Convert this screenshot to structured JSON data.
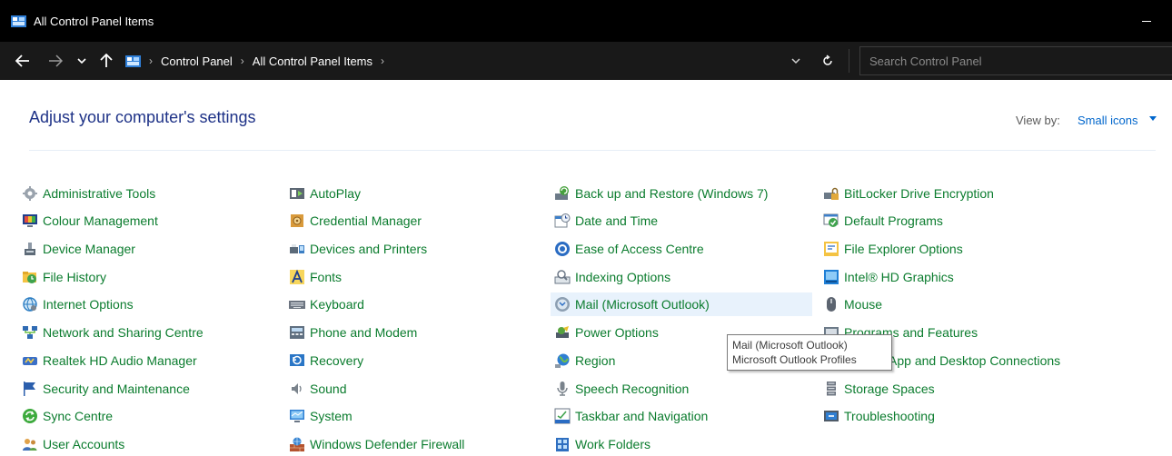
{
  "window": {
    "title": "All Control Panel Items"
  },
  "address": {
    "crumbs": [
      "Control Panel",
      "All Control Panel Items"
    ],
    "search_placeholder": "Search Control Panel"
  },
  "header": {
    "title": "Adjust your computer's settings",
    "view_by_label": "View by:",
    "view_by_value": "Small icons"
  },
  "columns": [
    [
      "Administrative Tools",
      "Colour Management",
      "Device Manager",
      "File History",
      "Internet Options",
      "Network and Sharing Centre",
      "Realtek HD Audio Manager",
      "Security and Maintenance",
      "Sync Centre",
      "User Accounts"
    ],
    [
      "AutoPlay",
      "Credential Manager",
      "Devices and Printers",
      "Fonts",
      "Keyboard",
      "Phone and Modem",
      "Recovery",
      "Sound",
      "System",
      "Windows Defender Firewall"
    ],
    [
      "Back up and Restore (Windows 7)",
      "Date and Time",
      "Ease of Access Centre",
      "Indexing Options",
      "Mail (Microsoft Outlook)",
      "Power Options",
      "Region",
      "Speech Recognition",
      "Taskbar and Navigation",
      "Work Folders"
    ],
    [
      "BitLocker Drive Encryption",
      "Default Programs",
      "File Explorer Options",
      "Intel® HD Graphics",
      "Mouse",
      "Programs and Features",
      "RemoteApp and Desktop Connections",
      "Storage Spaces",
      "Troubleshooting"
    ]
  ],
  "tooltip": {
    "line1": "Mail (Microsoft Outlook)",
    "line2": "Microsoft Outlook Profiles"
  },
  "colors": {
    "link": "#0b7c2e",
    "heading": "#1e3287",
    "view_by": "#0066cc",
    "hover": "#e8f2fc"
  }
}
